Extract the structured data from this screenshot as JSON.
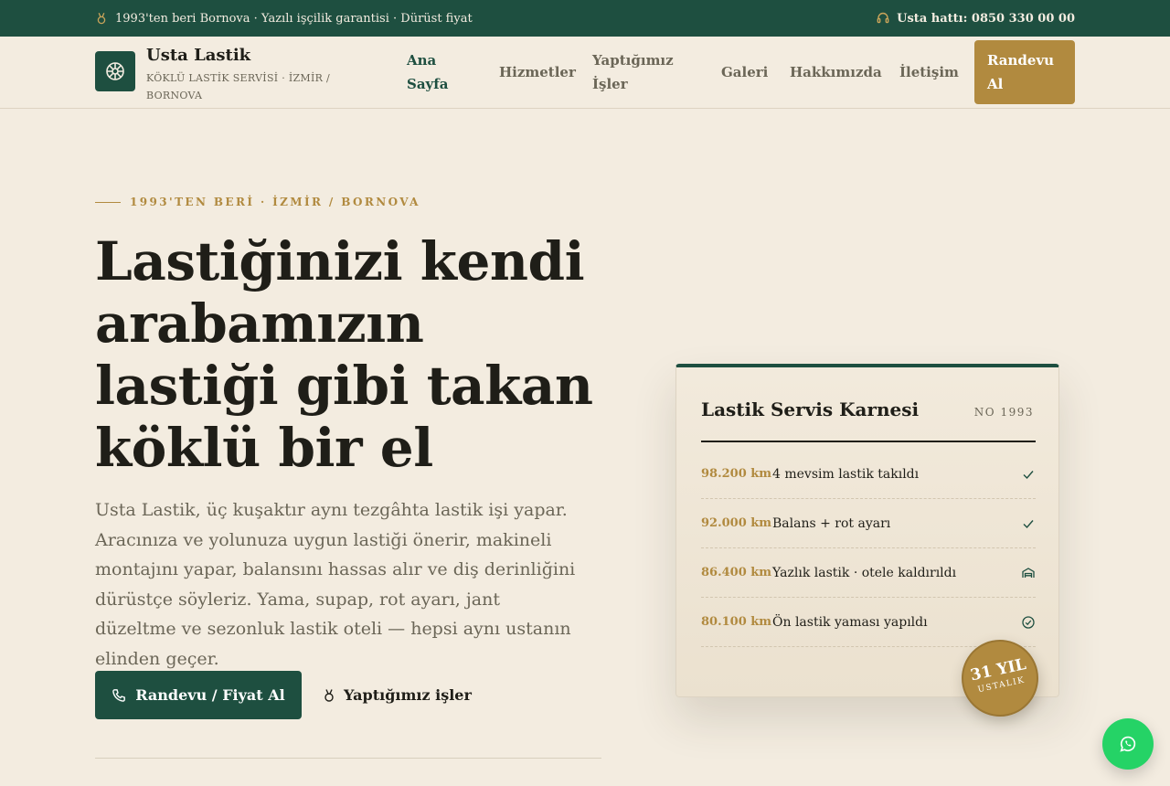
{
  "topbar": {
    "tagline": "1993'ten beri Bornova · Yazılı işçilik garantisi · Dürüst fiyat",
    "hotline": "Usta hattı: 0850 330 00 00"
  },
  "brand": {
    "name": "Usta Lastik",
    "subtitle": "KÖKLÜ LASTİK SERVİSİ · İZMİR / BORNOVA"
  },
  "nav": {
    "items": [
      {
        "label": "Ana Sayfa",
        "active": true
      },
      {
        "label": "Hizmetler"
      },
      {
        "label": "Yaptığımız İşler"
      },
      {
        "label": "Galeri"
      },
      {
        "label": "Hakkımızda"
      },
      {
        "label": "İletişim"
      }
    ],
    "cta": "Randevu Al"
  },
  "hero": {
    "eyebrow": "1993'TEN BERİ · İZMİR / BORNOVA",
    "title": "Lastiğinizi kendi arabamızın lastiği gibi takan köklü bir el",
    "text": "Usta Lastik, üç kuşaktır aynı tezgâhta lastik işi yapar. Aracınıza ve yolunuza uygun lastiği önerir, makineli montajını yapar, balansını hassas alır ve diş derinliğini dürüstçe söyleriz. Yama, supap, rot ayarı, jant düzeltme ve sezonluk lastik oteli — hepsi aynı ustanın elinden geçer.",
    "primary_button": "Randevu / Fiyat Al",
    "secondary_link": "Yaptığımız işler"
  },
  "card": {
    "title": "Lastik Servis Karnesi",
    "number": "NO 1993",
    "rows": [
      {
        "km": "98.200 km",
        "desc": "4 mevsim lastik takıldı",
        "icon": "check-icon"
      },
      {
        "km": "92.000 km",
        "desc": "Balans + rot ayarı",
        "icon": "check-icon"
      },
      {
        "km": "86.400 km",
        "desc": "Yazlık lastik · otele kaldırıldı",
        "icon": "storage-icon"
      },
      {
        "km": "80.100 km",
        "desc": "Ön lastik yaması yapıldı",
        "icon": "verified-icon"
      }
    ]
  },
  "seal": {
    "big": "31 YIL",
    "small": "USTALIK"
  },
  "colors": {
    "primary": "#1e4f40",
    "accent": "#b18a3f",
    "background": "#f3ece0",
    "whatsapp": "#25d366"
  }
}
